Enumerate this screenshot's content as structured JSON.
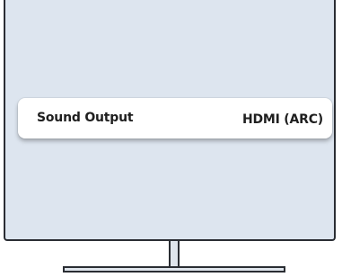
{
  "settings": {
    "sound_output": {
      "label": "Sound Output",
      "value": "HDMI (ARC)"
    }
  },
  "colors": {
    "screen_background": "#dde5ef",
    "row_background": "#ffffff",
    "text": "#1f1f1f",
    "frame": "#2a2d33"
  }
}
